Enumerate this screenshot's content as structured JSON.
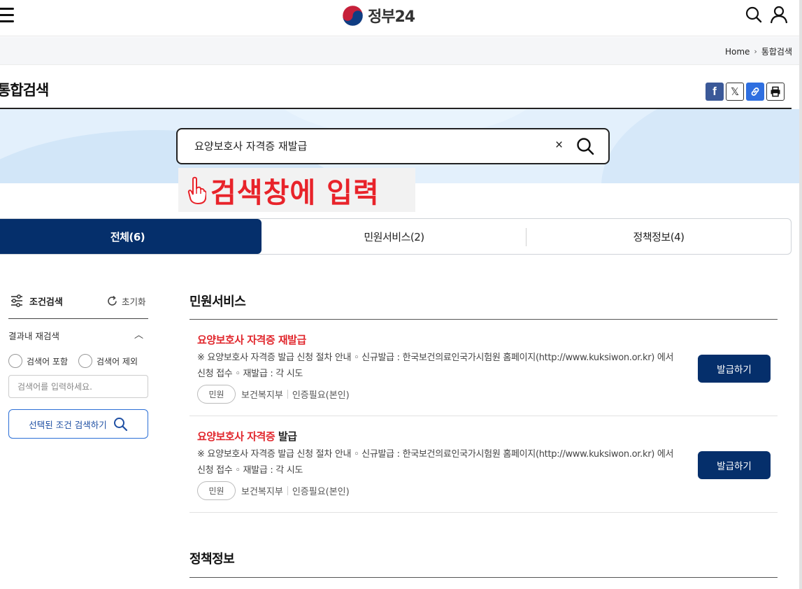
{
  "header": {
    "logo_text": "정부24",
    "menu_icon": "hamburger-menu-icon",
    "search_icon": "search-icon",
    "user_icon": "user-icon"
  },
  "breadcrumb": {
    "home": "Home",
    "current": "통합검색"
  },
  "page": {
    "title": "통합검색",
    "share": {
      "facebook_glyph": "f",
      "x_glyph": "𝕏"
    }
  },
  "search": {
    "query": "요양보호사 자격증 재발급",
    "clear_glyph": "×"
  },
  "annotation": {
    "text": "검색창에 입력",
    "color": "#e8232a"
  },
  "tabs": [
    {
      "label": "전체(6)",
      "active": true
    },
    {
      "label": "민원서비스(2)",
      "active": false
    },
    {
      "label": "정책정보(4)",
      "active": false
    }
  ],
  "filter": {
    "title": "조건검색",
    "reset_label": "초기화",
    "refine_label": "결과내 재검색",
    "chevron": "︿",
    "include_label": "검색어 포함",
    "exclude_label": "검색어 제외",
    "keyword_placeholder": "검색어를 입력하세요.",
    "submit_label": "선택된 조건 검색하기"
  },
  "sections": {
    "civil": {
      "title": "민원서비스",
      "results": [
        {
          "title_highlight": "요양보호사 자격증 재발급",
          "title_rest": "",
          "desc": "※ 요양보호사 자격증 발급 신청 절차 안내 ◦ 신규발급 : 한국보건의료인국가시험원 홈페이지(http://www.kuksiwon.or.kr) 에서 신청 접수 ◦ 재발급 : 각 시도",
          "chip": "민원",
          "agency": "보건복지부",
          "auth": "인증필요(본인)",
          "button": "발급하기"
        },
        {
          "title_highlight": "요양보호사 자격증",
          "title_rest": " 발급",
          "desc": "※ 요양보호사 자격증 발급 신청 절차 안내 ◦ 신규발급 : 한국보건의료인국가시험원 홈페이지(http://www.kuksiwon.or.kr) 에서 신청 접수 ◦ 재발급 : 각 시도",
          "chip": "민원",
          "agency": "보건복지부",
          "auth": "인증필요(본인)",
          "button": "발급하기"
        }
      ]
    },
    "policy": {
      "title": "정책정보"
    }
  },
  "colors": {
    "primary": "#052f6b",
    "highlight": "#e1262c",
    "band": "#e3f0fc"
  }
}
